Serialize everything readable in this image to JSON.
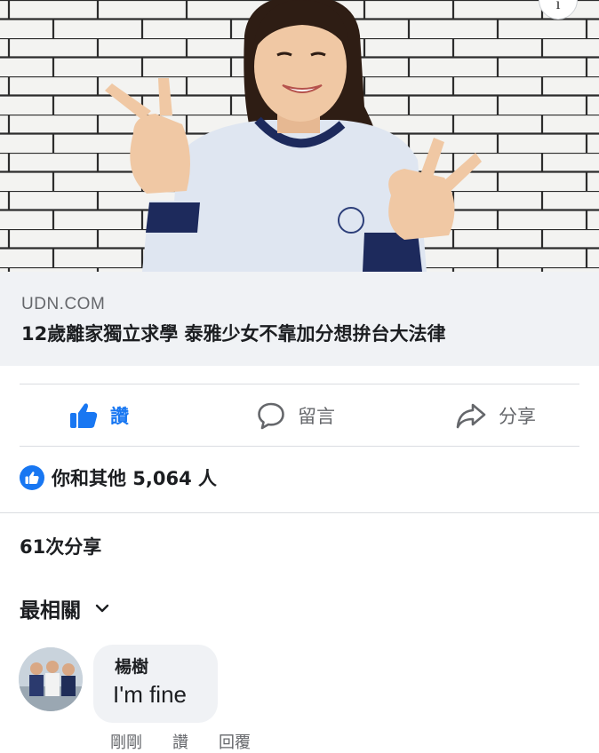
{
  "post": {
    "link_domain": "UDN.COM",
    "link_headline": "12歲離家獨立求學 泰雅少女不靠加分想拚台大法律",
    "corner_icon_glyph": "i"
  },
  "actions": {
    "like_label": "讚",
    "comment_label": "留言",
    "share_label": "分享",
    "like_icon": "thumbs-up-icon",
    "comment_icon": "speech-bubble-icon",
    "share_icon": "share-arrow-icon",
    "liked_color": "#1877f2"
  },
  "reactions": {
    "summary": "你和其他 5,064 人"
  },
  "shares": {
    "text": "61次分享"
  },
  "comments": {
    "sort_label": "最相關",
    "items": [
      {
        "author": "楊樹",
        "text": "I'm fine",
        "time": "剛剛",
        "like_action": "讚",
        "reply_action": "回覆"
      }
    ]
  }
}
